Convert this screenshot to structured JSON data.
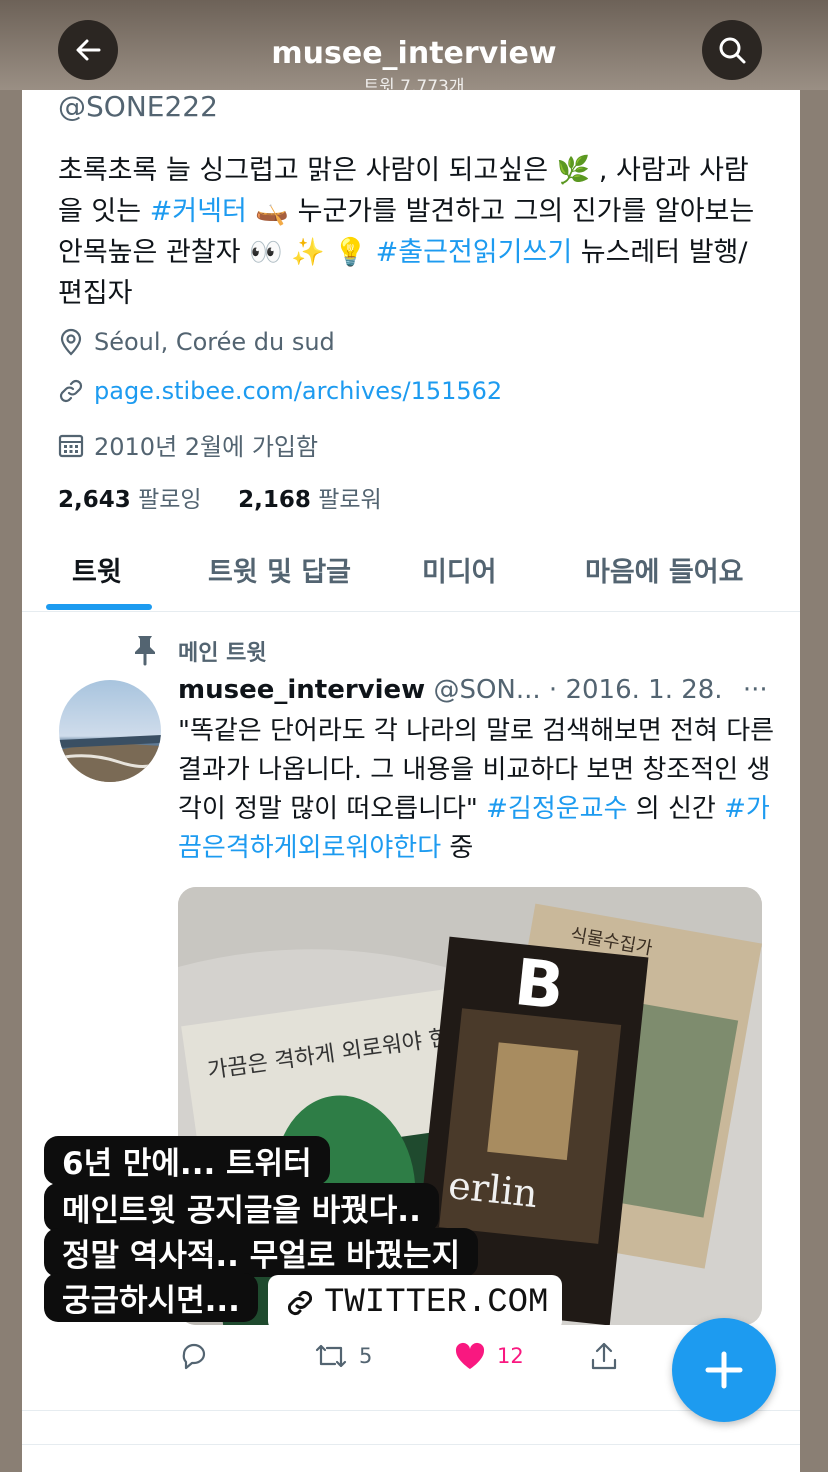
{
  "header": {
    "username": "musee_interview",
    "tweet_count": "트윗 7,773개"
  },
  "profile": {
    "handle": "@SONE222",
    "bio_1": "초록초록 늘 싱그럽고 맑은 사람이 되고싶은 🌿 , 사람과 사람을 잇는 ",
    "bio_tag1": "#커넥터",
    "bio_2": " 🛶 누군가를 발견하고 그의 진가를 알아보는 안목높은 관찰자 👀 ✨ 💡 ",
    "bio_tag2": "#출근전읽기쓰기",
    "bio_3": " 뉴스레터 발행/편집자",
    "location": "Séoul, Corée du sud",
    "website": "page.stibee.com/archives/151562",
    "joined": "2010년 2월에 가입함",
    "following_count": "2,643",
    "following_label": "팔로잉",
    "followers_count": "2,168",
    "followers_label": "팔로워"
  },
  "tabs": [
    {
      "label": "트윗"
    },
    {
      "label": "트윗 및 답글"
    },
    {
      "label": "미디어"
    },
    {
      "label": "마음에 들어요"
    }
  ],
  "tweet": {
    "pinned_label": "메인 트윗",
    "author": "musee_interview",
    "handle": "@SON...",
    "date": "· 2016. 1. 28.",
    "more": "···",
    "text_1": "\"똑같은 단어라도 각 나라의 말로 검색해보면 전혀 다른 결과가 나옵니다. 그 내용을 비교하다 보면 창조적인 생각이 정말 많이 떠오릅니다\" ",
    "tag1": "#김정운교수",
    "text_2": " 의 신간 ",
    "tag2": "#가끔은격하게외로워야한다",
    "text_3": " 중",
    "retweets": "5",
    "likes": "12",
    "photo_book1": "가끔은 격하게 외로워야 한다",
    "photo_magazine": "B",
    "photo_magazine_city": "erlin",
    "photo_book3": "식물수집가"
  },
  "story_overlay": {
    "line1": "6년 만에... 트위터",
    "line2": "메인트윗 공지글을 바꿨다..",
    "line3": "정말 역사적.. 무얼로 바꿨는지",
    "line4": "궁금하시면...",
    "link_label": "TWITTER.COM"
  },
  "colors": {
    "accent": "#1d9bf0",
    "like": "#f91880",
    "text": "#0f1419",
    "secondary": "#536471"
  }
}
